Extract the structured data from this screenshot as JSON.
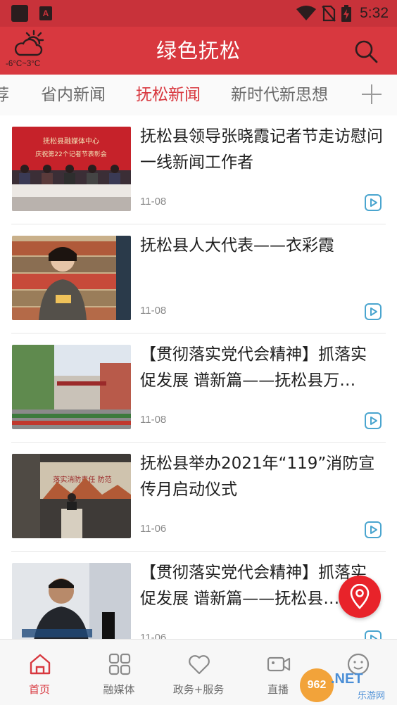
{
  "status_bar": {
    "time": "5:32",
    "app_letter": "A"
  },
  "header": {
    "title": "绿色抚松",
    "weather_temp": "-6°C~3°C",
    "weather_icon": "cloudy-sun-icon",
    "search_icon": "search-icon"
  },
  "tabs": {
    "items": [
      "荐",
      "省内新闻",
      "抚松新闻",
      "新时代新思想"
    ],
    "active": "抚松新闻",
    "add_icon": "plus-icon"
  },
  "feed": {
    "items": [
      {
        "title": "抚松县领导张晓霞记者节走访慰问一线新闻工作者",
        "date": "11-08",
        "has_video": true,
        "thumb_caption": "抚松县融媒体中心 庆祝第22个记者节表彰会"
      },
      {
        "title": "抚松县人大代表——衣彩霞",
        "date": "11-08",
        "has_video": true,
        "thumb_caption": ""
      },
      {
        "title": "【贯彻落实党代会精神】抓落实 促发展 谱新篇——抚松县万…",
        "date": "11-08",
        "has_video": true,
        "thumb_caption": ""
      },
      {
        "title": "抚松县举办2021年“119”消防宣传月启动仪式",
        "date": "11-06",
        "has_video": true,
        "thumb_caption": "落实消防责任 防范"
      },
      {
        "title": "【贯彻落实党代会精神】抓落实 促发展 谱新篇——抚松县…",
        "date": "11-06",
        "has_video": true,
        "thumb_caption": ""
      }
    ]
  },
  "fab": {
    "icon": "location-pin-icon"
  },
  "bottom_nav": {
    "items": [
      {
        "label": "首页",
        "icon": "home-icon",
        "active": true
      },
      {
        "label": "融媒体",
        "icon": "grid-icon",
        "active": false
      },
      {
        "label": "政务+服务",
        "icon": "heart-icon",
        "active": false
      },
      {
        "label": "直播",
        "icon": "video-camera-icon",
        "active": false
      },
      {
        "label": "我的",
        "icon": "smiley-icon",
        "active": false
      }
    ]
  },
  "watermark": {
    "badge": "962",
    "text": ".NET",
    "sub": "乐游网"
  },
  "colors": {
    "brand_red": "#d8383f",
    "status_red": "#c8323a",
    "accent_blue": "#4aa5cf"
  }
}
